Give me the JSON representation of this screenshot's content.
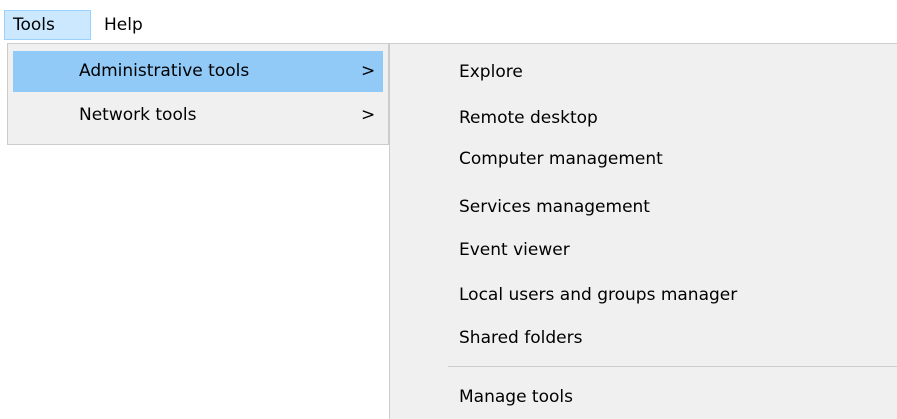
{
  "menubar": {
    "tools_label": "Tools",
    "help_label": "Help"
  },
  "tools_menu": {
    "items": [
      {
        "label": "Administrative tools",
        "arrow": ">"
      },
      {
        "label": "Network tools",
        "arrow": ">"
      }
    ]
  },
  "admin_submenu": {
    "items": [
      {
        "label": "Explore"
      },
      {
        "label": "Remote desktop"
      },
      {
        "label": "Computer management"
      },
      {
        "label": "Services management"
      },
      {
        "label": "Event viewer"
      },
      {
        "label": "Local users and groups manager"
      },
      {
        "label": "Shared folders"
      }
    ],
    "footer_item": {
      "label": "Manage tools"
    }
  },
  "colors": {
    "menubar_active_bg": "#cce8ff",
    "menu_highlight_bg": "#91c9f7",
    "menu_bg": "#f0f0f0",
    "menu_border": "#cccccc"
  }
}
